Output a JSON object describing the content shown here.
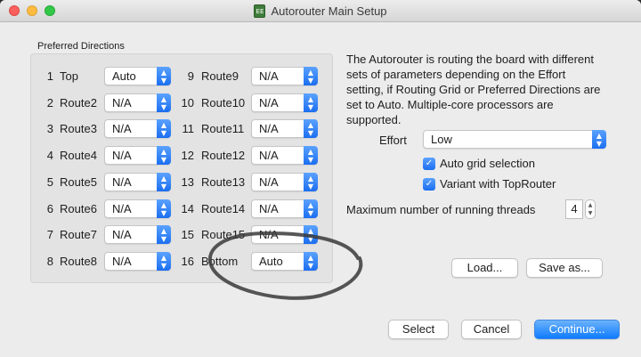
{
  "window": {
    "title": "Autorouter Main Setup",
    "app_icon_text": "EE"
  },
  "preferred_directions": {
    "label": "Preferred Directions",
    "left": [
      {
        "num": "1",
        "label": "Top",
        "value": "Auto"
      },
      {
        "num": "2",
        "label": "Route2",
        "value": "N/A"
      },
      {
        "num": "3",
        "label": "Route3",
        "value": "N/A"
      },
      {
        "num": "4",
        "label": "Route4",
        "value": "N/A"
      },
      {
        "num": "5",
        "label": "Route5",
        "value": "N/A"
      },
      {
        "num": "6",
        "label": "Route6",
        "value": "N/A"
      },
      {
        "num": "7",
        "label": "Route7",
        "value": "N/A"
      },
      {
        "num": "8",
        "label": "Route8",
        "value": "N/A"
      }
    ],
    "right": [
      {
        "num": "9",
        "label": "Route9",
        "value": "N/A"
      },
      {
        "num": "10",
        "label": "Route10",
        "value": "N/A"
      },
      {
        "num": "11",
        "label": "Route11",
        "value": "N/A"
      },
      {
        "num": "12",
        "label": "Route12",
        "value": "N/A"
      },
      {
        "num": "13",
        "label": "Route13",
        "value": "N/A"
      },
      {
        "num": "14",
        "label": "Route14",
        "value": "N/A"
      },
      {
        "num": "15",
        "label": "Route15",
        "value": "N/A"
      },
      {
        "num": "16",
        "label": "Bottom",
        "value": "Auto"
      }
    ]
  },
  "description": "The Autorouter is routing the board with different sets of parameters depending on the Effort setting, if Routing Grid or Preferred Directions are set to Auto. Multiple-core processors are supported.",
  "effort": {
    "label": "Effort",
    "value": "Low"
  },
  "options": {
    "auto_grid": {
      "label": "Auto grid selection",
      "checked": true
    },
    "variant": {
      "label": "Variant with TopRouter",
      "checked": true
    }
  },
  "threads": {
    "label": "Maximum number of running threads",
    "value": "4"
  },
  "buttons": {
    "load": "Load...",
    "save_as": "Save as...",
    "select": "Select",
    "cancel": "Cancel",
    "continue": "Continue..."
  },
  "icons": {
    "dropdown": "updown-chevron-icon",
    "checkbox": "checkmark-icon",
    "stepper": "stepper-icon"
  },
  "colors": {
    "accent": "#1b6ef0",
    "window_bg": "#ececec",
    "close": "#fc605c",
    "minimize": "#fdbc40",
    "maximize": "#34c84a"
  }
}
